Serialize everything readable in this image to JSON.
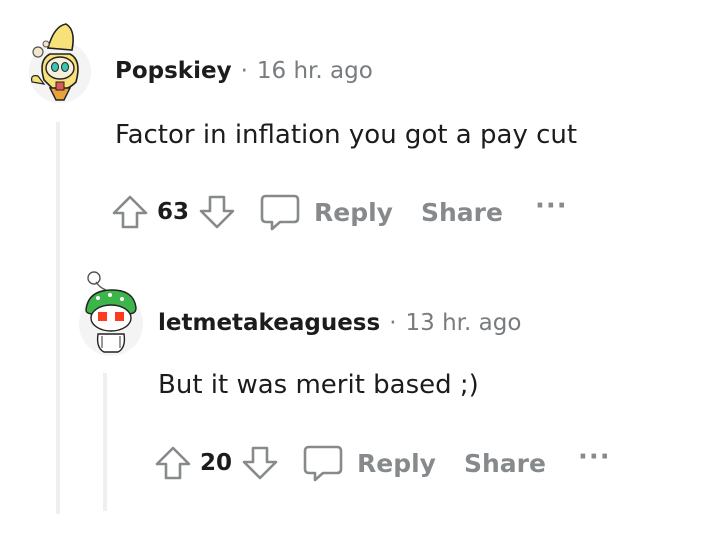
{
  "comments": [
    {
      "username": "Popskiey",
      "separator": "·",
      "time": "16 hr. ago",
      "body": "Factor in inflation you got a pay cut",
      "score": "63",
      "reply_label": "Reply",
      "share_label": "Share",
      "more_label": "···"
    },
    {
      "username": "letmetakeaguess",
      "separator": "·",
      "time": "13 hr. ago",
      "body": "But it was merit based ;)",
      "score": "20",
      "reply_label": "Reply",
      "share_label": "Share",
      "more_label": "···"
    }
  ],
  "icons": {
    "upvote": "arrow-up-icon",
    "downvote": "arrow-down-icon",
    "reply": "speech-bubble-icon"
  },
  "colors": {
    "thread_line": "#edeff1",
    "meta_gray": "#787c7e",
    "action_gray": "#878a8c",
    "text": "#1c1c1c"
  }
}
